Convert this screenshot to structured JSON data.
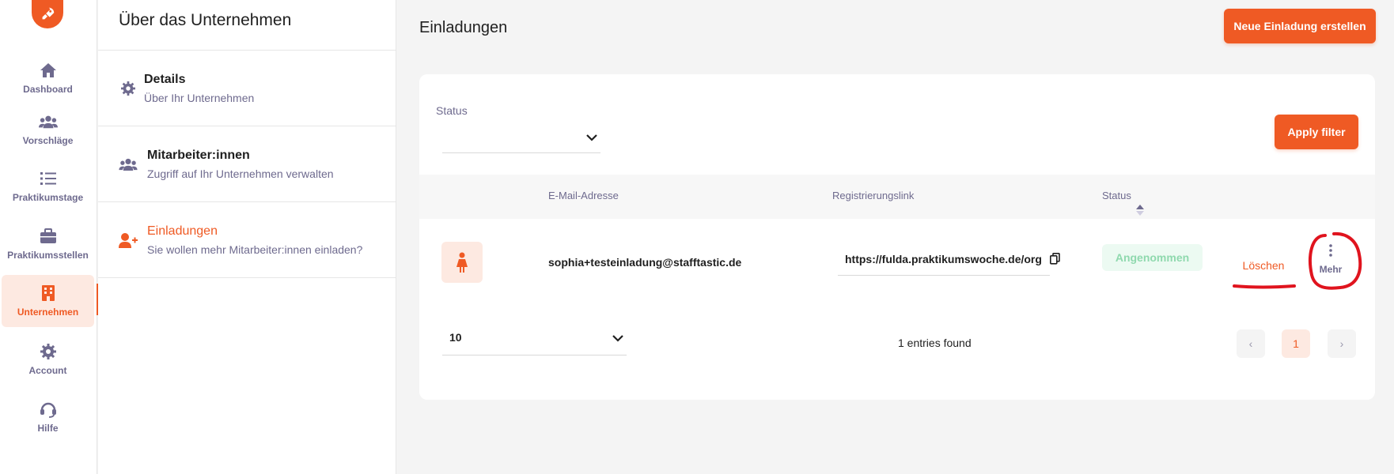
{
  "rail": {
    "items": [
      {
        "label": "Dashboard",
        "icon": "home-icon"
      },
      {
        "label": "Vorschläge",
        "icon": "users-icon"
      },
      {
        "label": "Praktikumstage",
        "icon": "list-icon"
      },
      {
        "label": "Praktikumsstellen",
        "icon": "briefcase-icon"
      },
      {
        "label": "Unternehmen",
        "icon": "building-icon",
        "active": true
      },
      {
        "label": "Account",
        "icon": "gear-icon"
      },
      {
        "label": "Hilfe",
        "icon": "headset-icon"
      }
    ]
  },
  "sidebar": {
    "title": "Über das Unternehmen",
    "items": [
      {
        "title": "Details",
        "subtitle": "Über Ihr Unternehmen",
        "icon": "gear-icon"
      },
      {
        "title": "Mitarbeiter:innen",
        "subtitle": "Zugriff auf Ihr Unternehmen verwalten",
        "icon": "users-icon"
      },
      {
        "title": "Einladungen",
        "subtitle": "Sie wollen mehr Mitarbeiter:innen einladen?",
        "icon": "user-plus-icon",
        "active": true
      }
    ]
  },
  "main": {
    "title": "Einladungen",
    "new_button": "Neue Einladung erstellen",
    "filter": {
      "label": "Status",
      "value": "",
      "apply": "Apply filter"
    },
    "table": {
      "columns": [
        "E-Mail-Adresse",
        "Registrierungslink",
        "Status"
      ],
      "rows": [
        {
          "email": "sophia+testeinladung@stafftastic.de",
          "link": "https://fulda.praktikumswoche.de/org",
          "status": "Angenommen",
          "delete": "Löschen",
          "more": "Mehr"
        }
      ]
    },
    "pagination": {
      "page_size": "10",
      "entries": "1 entries found",
      "prev": "‹",
      "current": "1",
      "next": "›"
    }
  },
  "colors": {
    "accent": "#ef5a24",
    "accent_light": "#fde9e1",
    "muted": "#6e6a8e",
    "success_bg": "#ecfaf2",
    "success_text": "#8fd9ae",
    "annotation": "#e0141e"
  }
}
